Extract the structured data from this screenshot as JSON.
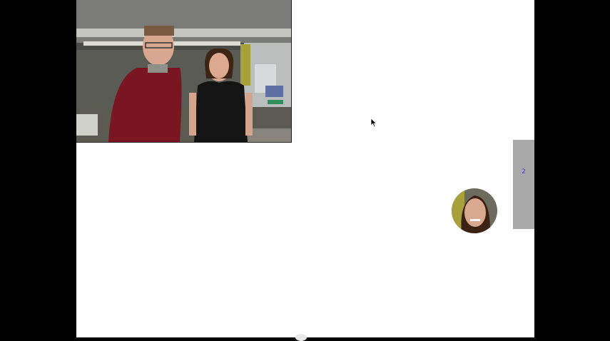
{
  "session": {
    "remote_video_label": "",
    "self_view_label": ""
  },
  "side_tab": {
    "label": "2"
  },
  "icons": {
    "pointer": "mouse-pointer-icon"
  },
  "colors": {
    "canvas": "#ffffff",
    "letterbox": "#000000",
    "tab": "#a9a9a9",
    "tab_text": "#3b3bd6"
  }
}
